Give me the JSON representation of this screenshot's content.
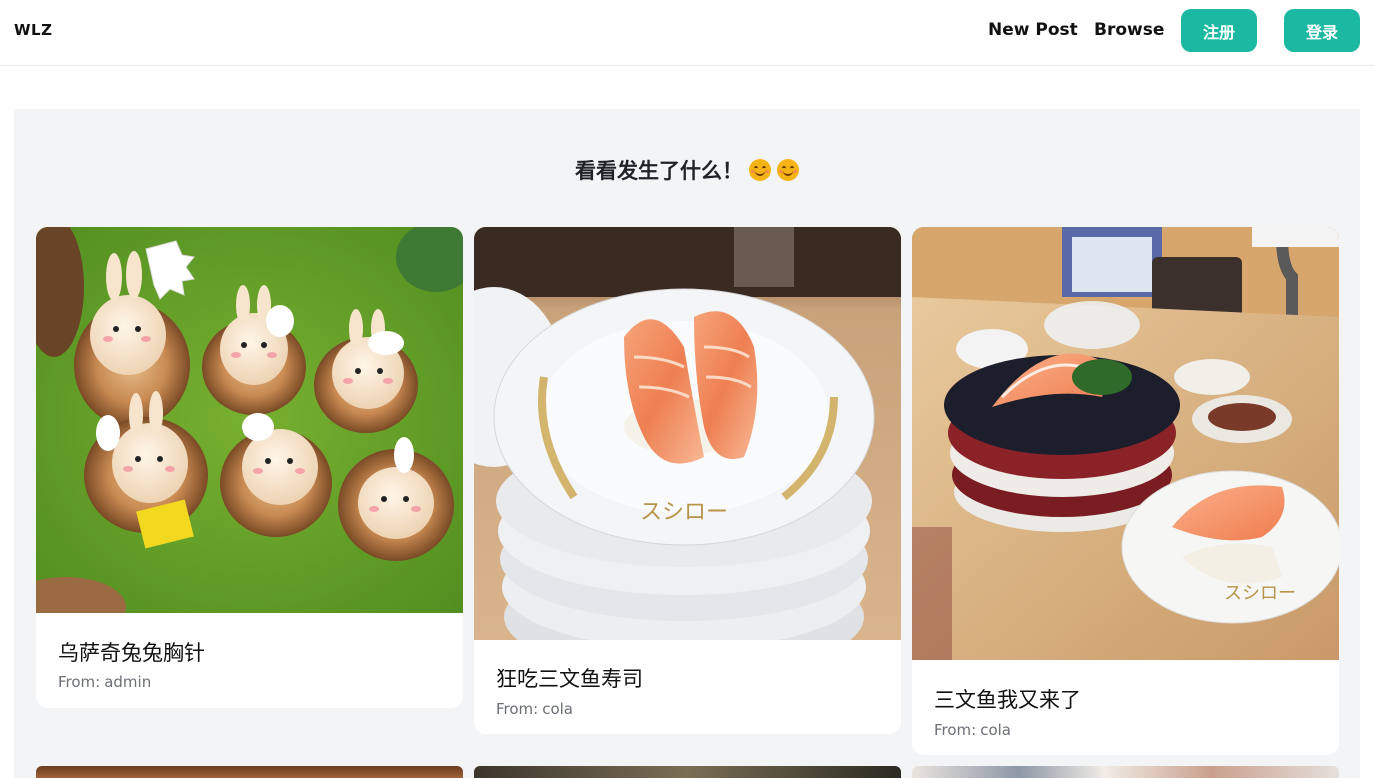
{
  "header": {
    "brand": "WLZ",
    "nav": {
      "new_post": "New Post",
      "browse": "Browse"
    },
    "buttons": {
      "register": "注册",
      "login": "登录"
    },
    "accent_color": "#1bb9a1"
  },
  "main": {
    "heading": "看看发生了什么！",
    "heading_emoji": "smiling-face-icon",
    "author_prefix": "From:",
    "posts": [
      {
        "title": "乌萨奇兔兔胸针",
        "author": "admin",
        "image": "chiikawa-usagi-plush-photo"
      },
      {
        "title": "狂吃三文鱼寿司",
        "author": "cola",
        "image": "salmon-sushi-plate-photo"
      },
      {
        "title": "三文鱼我又来了",
        "author": "cola",
        "image": "salmon-sashimi-table-photo"
      }
    ]
  }
}
